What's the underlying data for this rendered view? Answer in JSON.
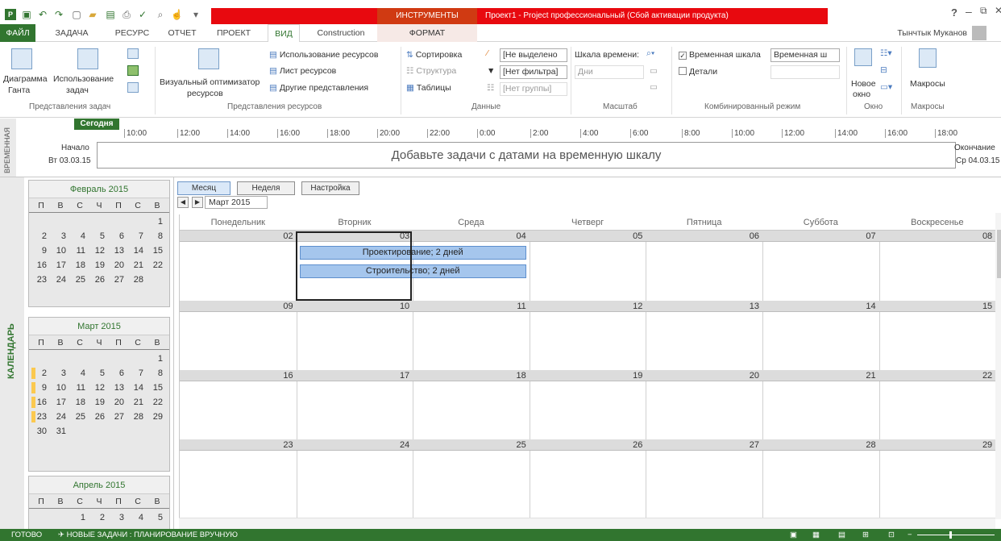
{
  "title": {
    "context_tab": "ИНСТРУМЕНТЫ КАЛЕНДАРЯ",
    "app_title": "Проект1 - Project профессиональный (Сбой активации продукта)",
    "help": "?"
  },
  "tabs": [
    "ФАЙЛ",
    "ЗАДАЧА",
    "РЕСУРС",
    "ОТЧЕТ",
    "ПРОЕКТ",
    "ВИД",
    "Construction",
    "ФОРМАТ"
  ],
  "user": "Тынчтык Муканов",
  "ribbon": {
    "gantt_line1": "Диаграмма",
    "gantt_line2": "Ганта",
    "usage_line1": "Использование",
    "usage_line2": "задач",
    "task_views_group": "Представления задач",
    "visual_line1": "Визуальный оптимизатор",
    "visual_line2": "ресурсов",
    "res_usage": "Использование ресурсов",
    "res_sheet": "Лист ресурсов",
    "other_views": "Другие представления",
    "res_views_group": "Представления ресурсов",
    "sort": "Сортировка",
    "outline": "Структура",
    "tables": "Таблицы",
    "highlight": "[Не выделено",
    "filter": "[Нет фильтра]",
    "group": "[Нет группы]",
    "data_group": "Данные",
    "timescale": "Шкала времени:",
    "days": "Дни",
    "zoom_group": "Масштаб",
    "timeline_check": "Временная шкала",
    "timeline_combo": "Временная ш",
    "details": "Детали",
    "combined_group": "Комбинированный режим",
    "new_window_line1": "Новое",
    "new_window_line2": "окно",
    "window_group": "Окно",
    "macros": "Макросы",
    "macros_group": "Макросы"
  },
  "timeline": {
    "side_label": "ВРЕМЕННАЯ",
    "today": "Сегодня",
    "start_label": "Начало",
    "start_date": "Вт 03.03.15",
    "end_label": "Окончание",
    "end_date": "Ср 04.03.15",
    "message": "Добавьте задачи с датами на временную шкалу",
    "ticks": [
      "10:00",
      "12:00",
      "14:00",
      "16:00",
      "18:00",
      "20:00",
      "22:00",
      "0:00",
      "2:00",
      "4:00",
      "6:00",
      "8:00",
      "10:00",
      "12:00",
      "14:00",
      "16:00",
      "18:00"
    ]
  },
  "calendar_side_label": "КАЛЕНДАРЬ",
  "mini_calendars": [
    {
      "title": "Февраль 2015",
      "dows": [
        "П",
        "В",
        "С",
        "Ч",
        "П",
        "С",
        "В"
      ],
      "rows": [
        [
          "",
          "",
          "",
          "",
          "",
          "",
          "1"
        ],
        [
          "2",
          "3",
          "4",
          "5",
          "6",
          "7",
          "8"
        ],
        [
          "9",
          "10",
          "11",
          "12",
          "13",
          "14",
          "15"
        ],
        [
          "16",
          "17",
          "18",
          "19",
          "20",
          "21",
          "22"
        ],
        [
          "23",
          "24",
          "25",
          "26",
          "27",
          "28",
          ""
        ]
      ]
    },
    {
      "title": "Март 2015",
      "dows": [
        "П",
        "В",
        "С",
        "Ч",
        "П",
        "С",
        "В"
      ],
      "rows": [
        [
          "",
          "",
          "",
          "",
          "",
          "",
          "1"
        ],
        [
          "2",
          "3",
          "4",
          "5",
          "6",
          "7",
          "8"
        ],
        [
          "9",
          "10",
          "11",
          "12",
          "13",
          "14",
          "15"
        ],
        [
          "16",
          "17",
          "18",
          "19",
          "20",
          "21",
          "22"
        ],
        [
          "23",
          "24",
          "25",
          "26",
          "27",
          "28",
          "29"
        ],
        [
          "30",
          "31",
          "",
          "",
          "",
          "",
          ""
        ]
      ]
    },
    {
      "title": "Апрель 2015",
      "dows": [
        "П",
        "В",
        "С",
        "Ч",
        "П",
        "С",
        "В"
      ],
      "rows": [
        [
          "",
          "",
          "1",
          "2",
          "3",
          "4",
          "5"
        ]
      ]
    }
  ],
  "view_tabs": {
    "month": "Месяц",
    "week": "Неделя",
    "custom": "Настройка"
  },
  "month_label": "Март 2015",
  "weekdays": [
    "Понедельник",
    "Вторник",
    "Среда",
    "Четверг",
    "Пятница",
    "Суббота",
    "Воскресенье"
  ],
  "weeks": [
    [
      "02",
      "03",
      "04",
      "05",
      "06",
      "07",
      "08"
    ],
    [
      "09",
      "10",
      "11",
      "12",
      "13",
      "14",
      "15"
    ],
    [
      "16",
      "17",
      "18",
      "19",
      "20",
      "21",
      "22"
    ],
    [
      "23",
      "24",
      "25",
      "26",
      "27",
      "28",
      "29"
    ]
  ],
  "tasks": [
    {
      "label": "Проектирование; 2 дней"
    },
    {
      "label": "Строительство; 2 дней"
    }
  ],
  "status": {
    "ready": "ГОТОВО",
    "new_tasks": "НОВЫЕ ЗАДАЧИ : ПЛАНИРОВАНИЕ ВРУЧНУЮ"
  },
  "colors": {
    "accent": "#31752f",
    "task_fill": "#a5c6ed",
    "title_red": "#e8090f"
  }
}
